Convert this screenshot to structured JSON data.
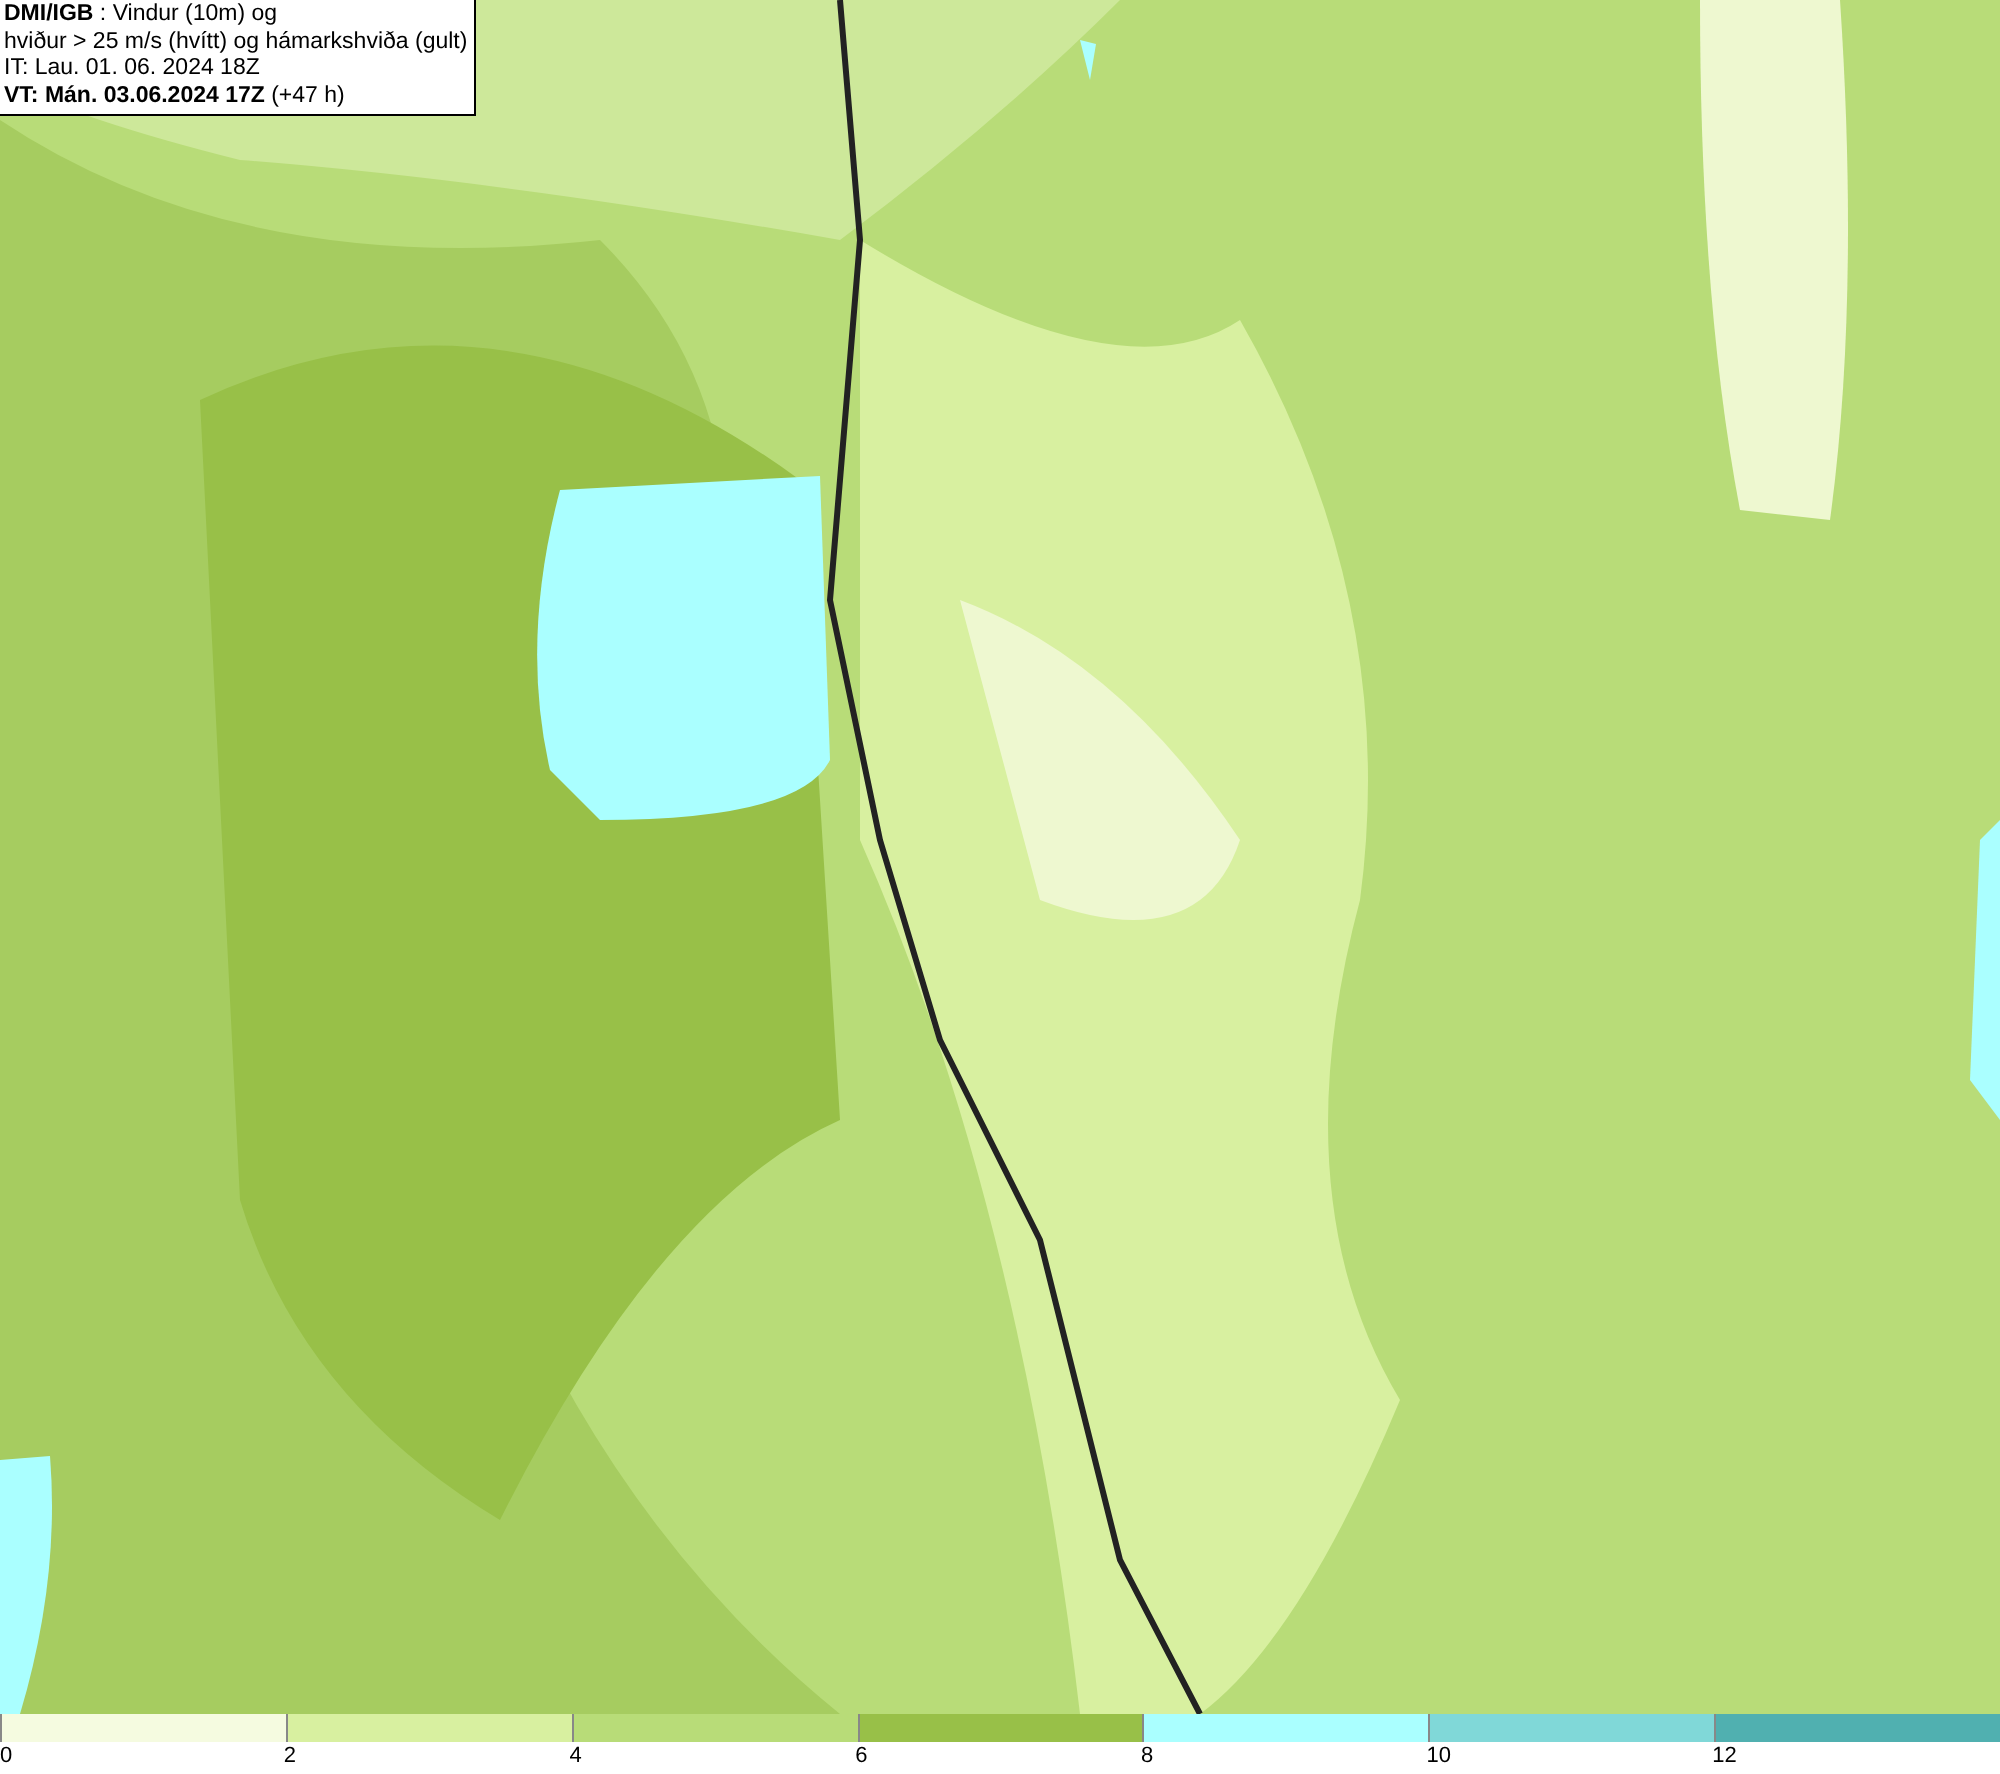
{
  "header": {
    "lines": [
      "**DMI/IGB** : Vindur (10m) og",
      "hviður > 25 m/s (hvítt) og hámarkshviða (gult)",
      "IT: Lau. 01. 06. 2024 18Z",
      "**VT: Mán. 03.06.2024 17Z** (+47 h)"
    ]
  },
  "legend": [
    {
      "label": "0",
      "color": "#f5fbe0"
    },
    {
      "label": "2",
      "color": "#d8f0a0"
    },
    {
      "label": "4",
      "color": "#b8dc78"
    },
    {
      "label": "6",
      "color": "#98c048"
    },
    {
      "label": "8",
      "color": "#aaffff"
    },
    {
      "label": "10",
      "color": "#80d8d8"
    },
    {
      "label": "12",
      "color": "#50b0b0"
    }
  ]
}
